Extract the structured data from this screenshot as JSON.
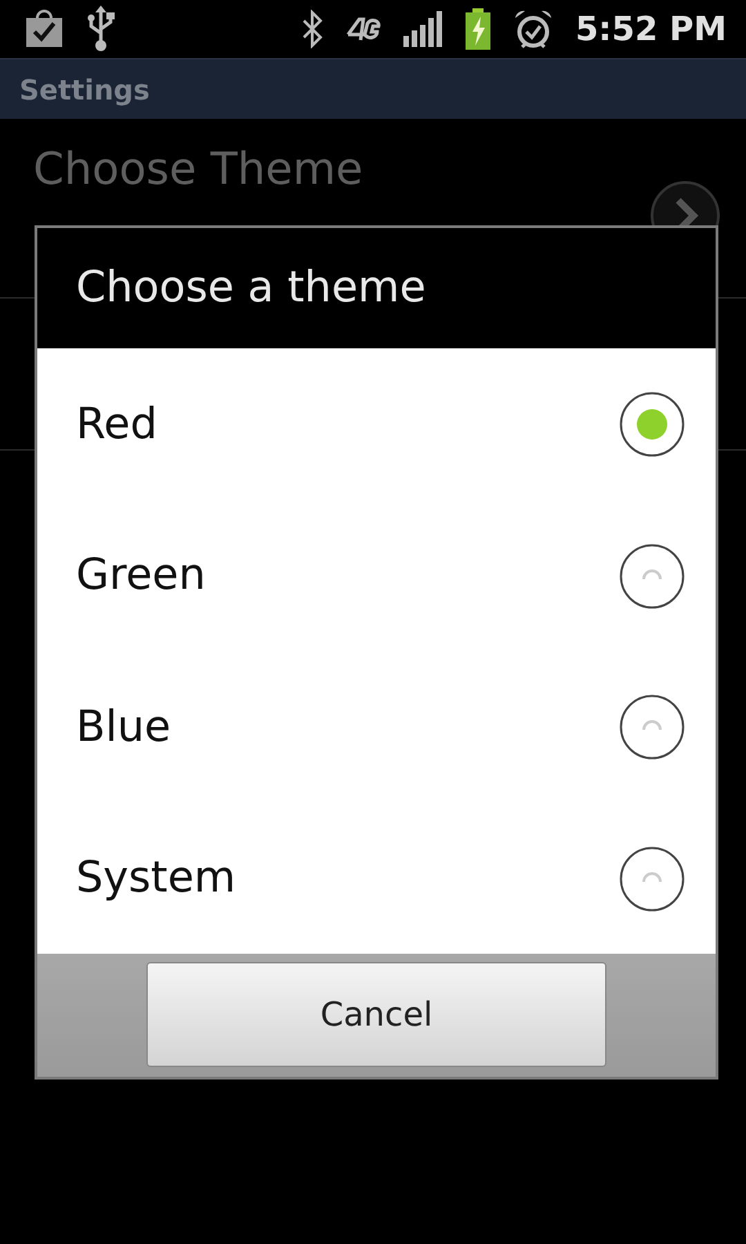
{
  "status_bar": {
    "time": "5:52 PM"
  },
  "title_bar": {
    "title": "Settings"
  },
  "settings_list": [
    {
      "title": "Choose Theme"
    }
  ],
  "dialog": {
    "title": "Choose a theme",
    "options": [
      {
        "label": "Red",
        "selected": true
      },
      {
        "label": "Green",
        "selected": false
      },
      {
        "label": "Blue",
        "selected": false
      },
      {
        "label": "System",
        "selected": false
      }
    ],
    "buttons": [
      "Cancel"
    ]
  }
}
